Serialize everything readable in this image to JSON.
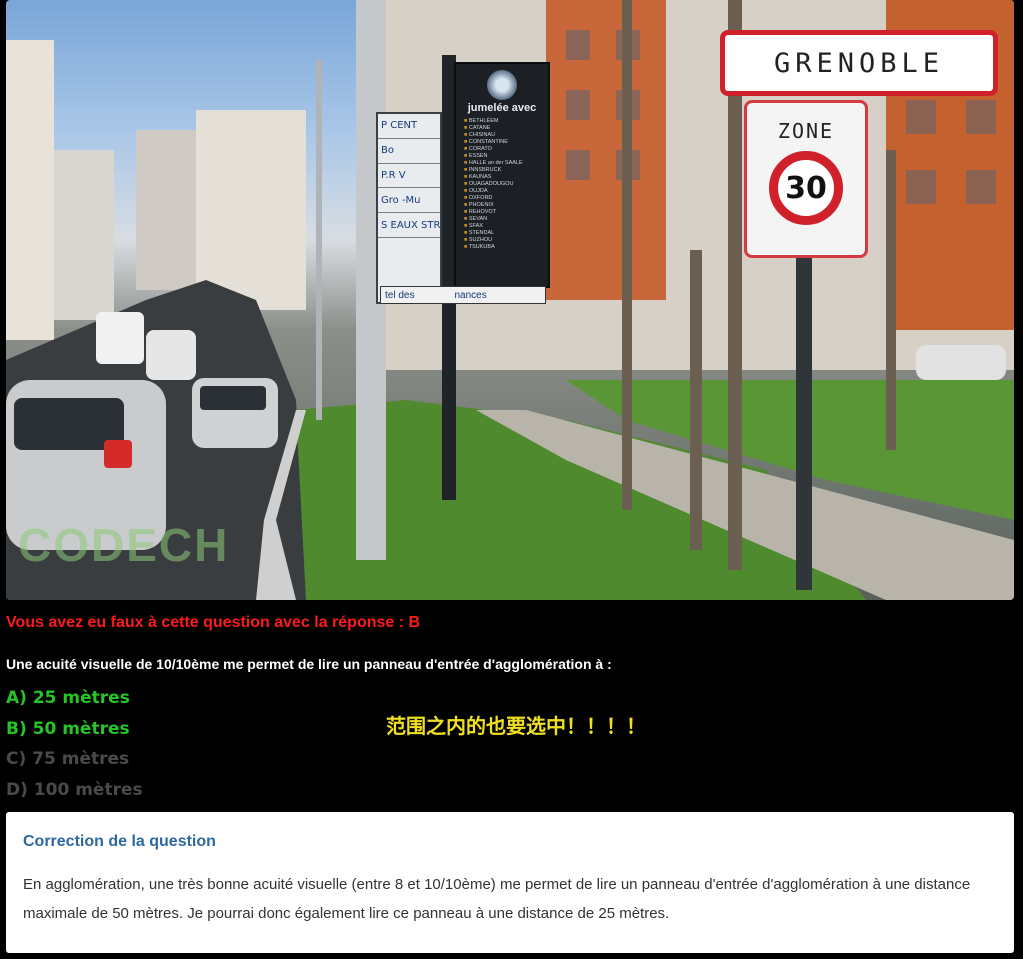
{
  "photo": {
    "alt_description": "",
    "city_sign_text": "GRENOBLE",
    "zone_sign_label": "ZONE",
    "speed_limit": "30",
    "twin_panel_title": "jumelée avec",
    "twin_cities": [
      "BETHLÉEM",
      "CATANE",
      "CHISINAU",
      "CONSTANTINE",
      "CORATO",
      "ESSEN",
      "HALLE an der SAALE",
      "INNSBRUCK",
      "KAUNAS",
      "OUAGADOUGOU",
      "OUJDA",
      "OXFORD",
      "PHOENIX",
      "REHOVOT",
      "SEVAN",
      "SFAX",
      "STENDAL",
      "SUZHOU",
      "TSUKUBA"
    ],
    "direction_signs": [
      "P CENT",
      "Bo",
      "P.R V",
      "Gro -Mu",
      "S EAUX STRAL"
    ],
    "hotel_sign": [
      "tel des",
      "nances"
    ],
    "watermark": "CODECH"
  },
  "result_text": "Vous avez eu faux à cette question avec la réponse : B",
  "question_text": "Une acuité visuelle de 10/10ème me permet de lire un panneau d'entrée d'agglomération à :",
  "answers": [
    {
      "label": "A) 25 mètres",
      "state": "correct"
    },
    {
      "label": "B) 50 mètres",
      "state": "correct"
    },
    {
      "label": "C) 75 mètres",
      "state": "muted"
    },
    {
      "label": "D) 100 mètres",
      "state": "muted"
    }
  ],
  "annotation_note": "范围之内的也要选中！！！！",
  "correction": {
    "title": "Correction de la question",
    "body": "En agglomération, une très bonne acuité visuelle (entre 8 et 10/10ème) me permet de lire un panneau d'entrée d'agglomération à une distance maximale de 50 mètres. Je pourrai donc également lire ce panneau à une distance de 25 mètres."
  },
  "colors": {
    "wrong": "#ff1a1a",
    "correct": "#27c427",
    "muted": "#4a4a4a",
    "note": "#f1e020",
    "card_title": "#2d69a0"
  }
}
